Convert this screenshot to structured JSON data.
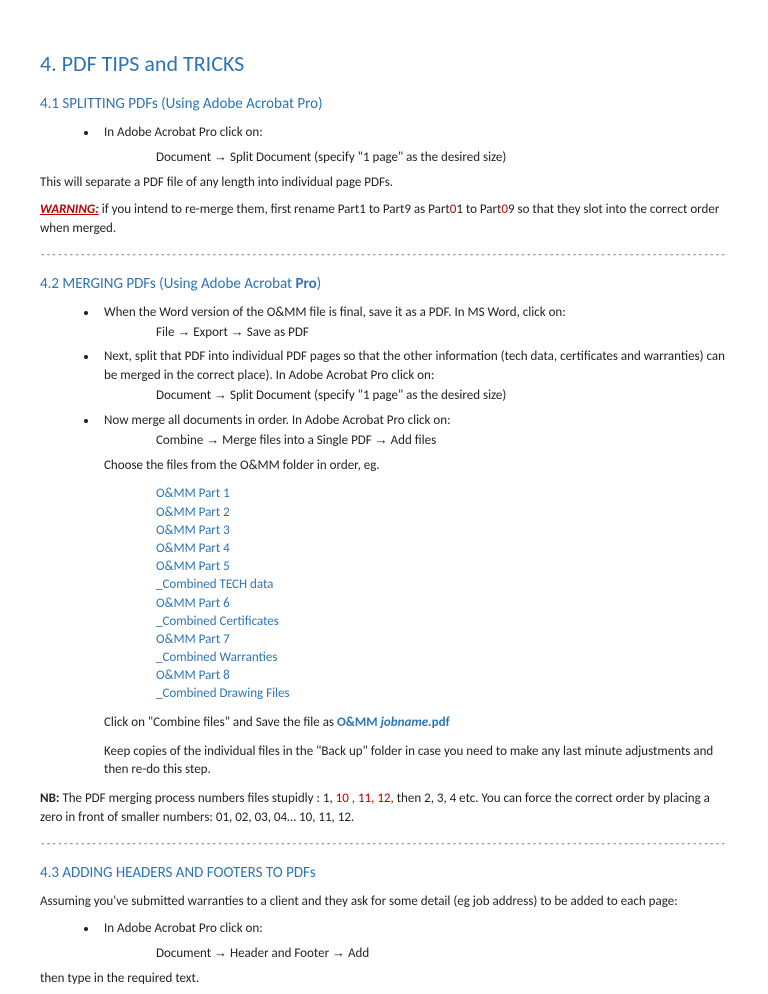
{
  "title": "4. PDF TIPS and TRICKS",
  "s41": {
    "heading": "4.1 SPLITTING PDFs (Using Adobe Acrobat Pro)",
    "li1": "In Adobe Acrobat Pro click on:",
    "path1a": "Document ",
    "path1b": " Split Document (specify \"1 page\" as the desired size)",
    "p1": "This will separate a PDF file of any length into individual page PDFs.",
    "warnLabel": "WARNING:",
    "warn1": " if you intend to re-merge them, first rename Part1 to Part9 as Part",
    "warn2": "0",
    "warn3": "1 to Part",
    "warn4": "0",
    "warn5": "9 so that they slot into the correct order when merged."
  },
  "dash": "-----------------------------------------------------------------------------------------------------------------------------------------",
  "s42": {
    "heading_a": "4.2 MERGING PDFs (Using Adobe Acrobat ",
    "heading_b": "Pro",
    "heading_c": ")",
    "li1": "When the Word version of the O&MM file is final, save it as a PDF. In MS Word, click on:",
    "path1a": "File ",
    "path1b": " Export ",
    "path1c": " Save as PDF",
    "li2": "Next, split that PDF into individual PDF pages so that the other information (tech data, certificates and warranties) can be merged in the correct place). In Adobe Acrobat Pro click on:",
    "path2a": "Document ",
    "path2b": " Split Document (specify \"1 page\" as the desired size)",
    "li3": "Now merge all documents in order. In Adobe Acrobat Pro click on:",
    "path3a": "Combine ",
    "path3b": " Merge files into a Single PDF ",
    "path3c": " Add files",
    "choose": "Choose the files from the O&MM folder in order, eg.",
    "files": [
      "O&MM Part 1",
      "O&MM Part 2",
      "O&MM Part 3",
      "O&MM Part 4",
      "O&MM Part 5",
      "_Combined TECH data",
      "O&MM Part 6",
      "_Combined Certificates",
      "O&MM Part 7",
      "_Combined Warranties",
      "O&MM Part 8",
      "_Combined Drawing Files"
    ],
    "combine_a": "Click on \"Combine files\" and Save the file as ",
    "combine_b": "O&MM ",
    "combine_c": "jobname",
    "combine_d": ".pdf",
    "keep": "Keep copies of the individual files in the \"Back up\" folder in case you need to make any last  minute adjustments and then re-do this step.",
    "nb_label": "NB:",
    "nb_a": " The PDF merging process numbers files stupidly : 1, ",
    "nb_b": "10 , 11, 12,",
    "nb_c": " then 2, 3, 4 etc. You can force the correct order by placing a zero in front of smaller numbers: 01, 02, 03, 04… 10, 11, 12."
  },
  "s43": {
    "heading": "4.3 ADDING HEADERS AND FOOTERS TO PDFs",
    "p1": "Assuming you've submitted warranties to a client and they ask for some detail (eg job address) to be added to each page:",
    "li1": "In Adobe Acrobat Pro click on:",
    "path1a": "Document ",
    "path1b": " Header and Footer ",
    "path1c": " Add",
    "p2": "then type in the required text."
  },
  "arrow": "→"
}
